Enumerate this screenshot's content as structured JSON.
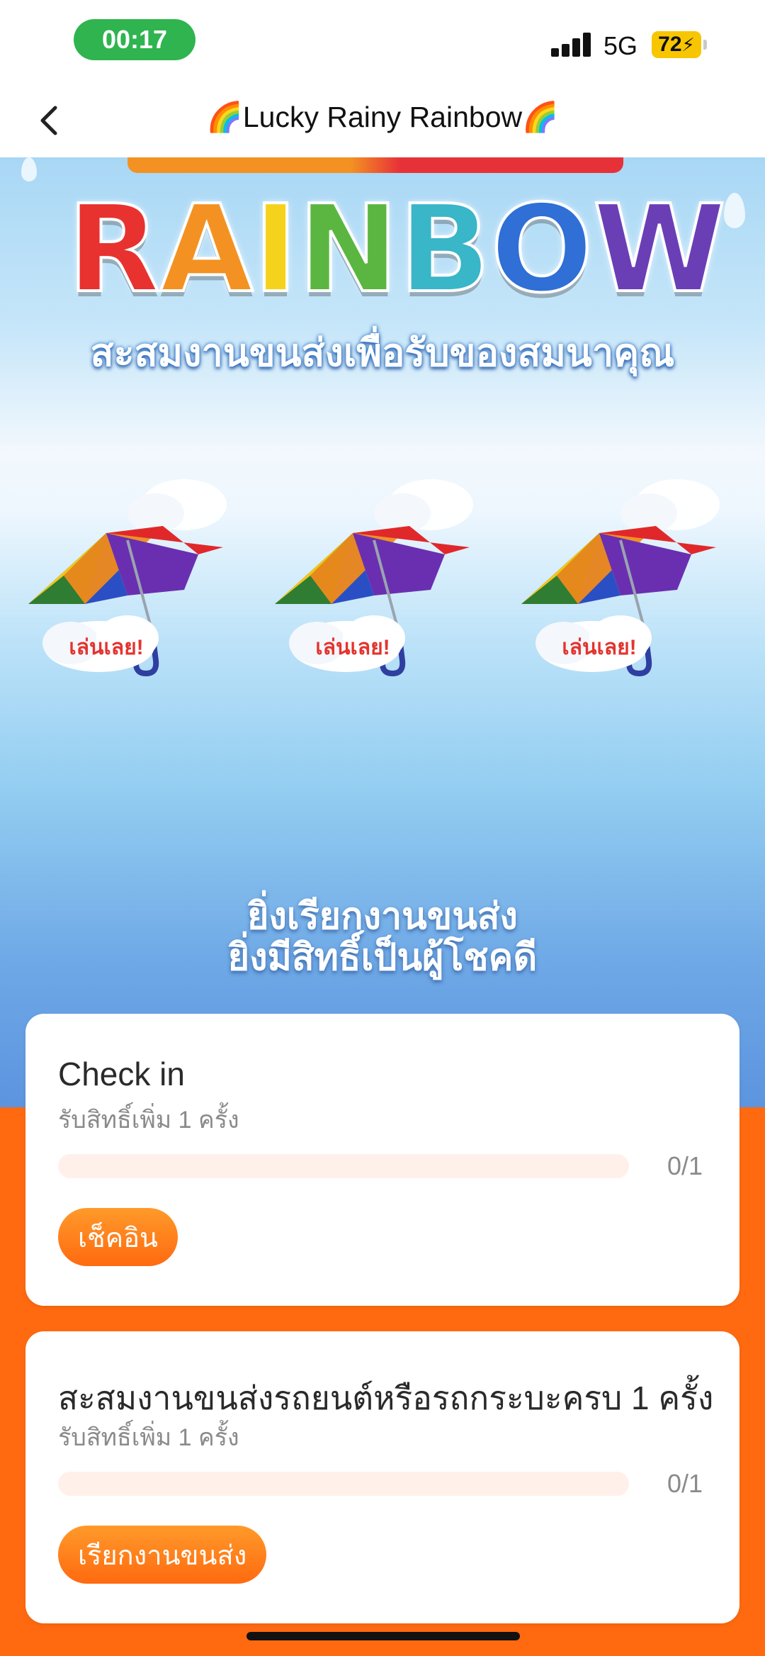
{
  "status_bar": {
    "time": "00:17",
    "network": "5G",
    "battery": "72"
  },
  "nav": {
    "title": "🌈Lucky Rainy Rainbow🌈",
    "back_icon": "chevron-left-icon"
  },
  "hero": {
    "logo_word": [
      "R",
      "A",
      "I",
      "N",
      "B",
      "O",
      "W"
    ],
    "logo_colors": [
      "#e8322f",
      "#f39222",
      "#f5d21c",
      "#5bb641",
      "#39b6c8",
      "#2f6fd6",
      "#6a3fb5"
    ],
    "subtitle": "สะสมงานขนส่งเพื่อรับของสมนาคุณ",
    "play_label": "เล่นเลย!",
    "umbrellas": [
      "umbrella-1",
      "umbrella-2",
      "umbrella-3"
    ],
    "tagline_line1": "ยิ่งเรียกงานขนส่ง",
    "tagline_line2": "ยิ่งมีสิทธิ์เป็นผู้โชคดี"
  },
  "tasks": [
    {
      "title": "Check in",
      "subtitle": "รับสิทธิ์เพิ่ม 1 ครั้ง",
      "progress": 0,
      "count": "0/1",
      "button": "เช็คอิน"
    },
    {
      "title": "สะสมงานขนส่งรถยนต์หรือรถกระบะครบ 1 ครั้ง",
      "subtitle": "รับสิทธิ์เพิ่ม 1 ครั้ง",
      "progress": 0,
      "count": "0/1",
      "button": "เรียกงานขนส่ง"
    }
  ],
  "colors": {
    "accent": "#ff6a10",
    "track": "#fff0ea",
    "status_pill": "#2fb44f",
    "battery": "#f7c600"
  }
}
